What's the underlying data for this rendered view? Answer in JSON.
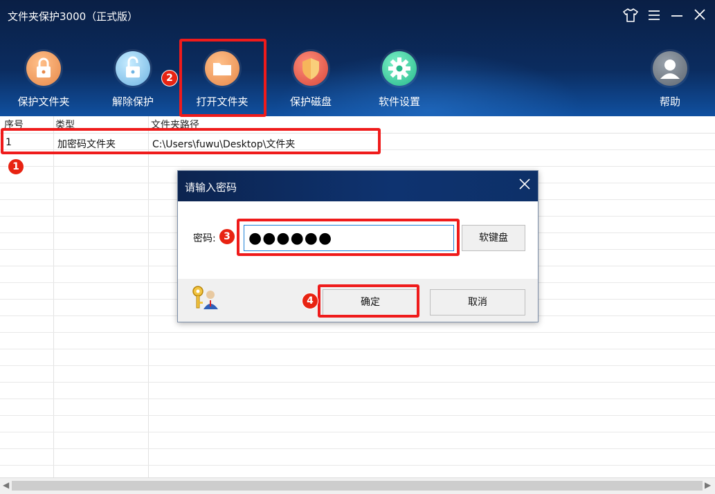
{
  "window": {
    "title": "文件夹保护3000（正式版）",
    "controls": {
      "skin_icon": "shirt-icon",
      "menu_icon": "menu-icon",
      "minimize_icon": "minimize-icon",
      "close_icon": "close-icon"
    }
  },
  "toolbar": {
    "items": [
      {
        "label": "保护文件夹",
        "icon": "lock-icon"
      },
      {
        "label": "解除保护",
        "icon": "unlock-icon"
      },
      {
        "label": "打开文件夹",
        "icon": "folder-icon"
      },
      {
        "label": "保护磁盘",
        "icon": "shield-icon"
      },
      {
        "label": "软件设置",
        "icon": "gear-icon"
      },
      {
        "label": "帮助",
        "icon": "user-icon"
      }
    ]
  },
  "table": {
    "columns": [
      "序号",
      "类型",
      "文件夹路径"
    ],
    "rows": [
      {
        "index": "1",
        "type": "加密码文件夹",
        "path": "C:\\Users\\fuwu\\Desktop\\文件夹"
      }
    ]
  },
  "dialog": {
    "title": "请输入密码",
    "password_label": "密码:",
    "password_value": "●●●●●●",
    "keyboard_button": "软键盘",
    "ok_button": "确定",
    "cancel_button": "取消"
  },
  "annotations": [
    "1",
    "2",
    "3",
    "4"
  ],
  "colors": {
    "annotation": "#ef1b1b",
    "header_dark": "#0a1f45",
    "input_border": "#1a7fd6"
  }
}
